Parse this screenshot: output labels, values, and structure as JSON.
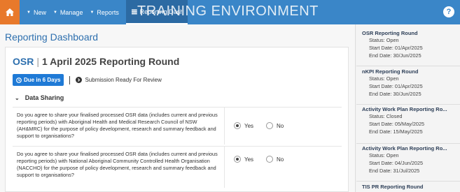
{
  "topbar": {
    "nav": [
      {
        "label": "New"
      },
      {
        "label": "Manage"
      },
      {
        "label": "Reports"
      }
    ],
    "active_tab": "Reporting Dashboard",
    "watermark": "TRAINING ENVIRONMENT",
    "help": "?"
  },
  "main": {
    "page_title": "Reporting Dashboard",
    "round": {
      "prefix": "OSR",
      "title": "1 April 2025 Reporting Round"
    },
    "due_badge": "Due in 6 Days",
    "status": "Submission Ready For Review",
    "section": "Data Sharing",
    "questions": [
      {
        "text": "Do you agree to share your finalised processed OSR data (includes current and previous reporting periods) with Aboriginal Health and Medical Research Council of NSW (AH&MRC) for the purpose of policy development, research and summary feedback and support to organisations?",
        "yes": "Yes",
        "no": "No",
        "selected": "Yes"
      },
      {
        "text": "Do you agree to share your finalised processed OSR data (includes current and previous reporting periods) with National Aboriginal Community Controlled Health Organisation (NACCHO) for the purpose of policy development, research and summary feedback and support to organisations?",
        "yes": "Yes",
        "no": "No",
        "selected": "Yes"
      }
    ]
  },
  "sidebar": {
    "rounds": [
      {
        "title": "OSR Reporting Round",
        "status": "Status: Open",
        "start": "Start Date: 01/Apr/2025",
        "end": "End Date: 30/Jun/2025"
      },
      {
        "title": "nKPI Reporting Round",
        "status": "Status: Open",
        "start": "Start Date: 01/Apr/2025",
        "end": "End Date: 30/Jun/2025"
      },
      {
        "title": "Activity Work Plan Reporting Ro...",
        "status": "Status: Closed",
        "start": "Start Date: 05/May/2025",
        "end": "End Date: 15/May/2025"
      },
      {
        "title": "Activity Work Plan Reporting Ro...",
        "status": "Status: Open",
        "start": "Start Date: 04/Jun/2025",
        "end": "End Date: 31/Jul/2025"
      },
      {
        "title": "TIS PR Reporting Round"
      }
    ]
  },
  "colors": {
    "topbar": "#3a86c8",
    "home": "#e8792b",
    "accent": "#2d6fae",
    "badge": "#1f7ad6"
  },
  "icons": {
    "home": "home-icon",
    "help": "help-icon",
    "clock": "clock-icon",
    "status": "arrow-right-circle-icon",
    "chevron": "chevron-down-icon"
  }
}
